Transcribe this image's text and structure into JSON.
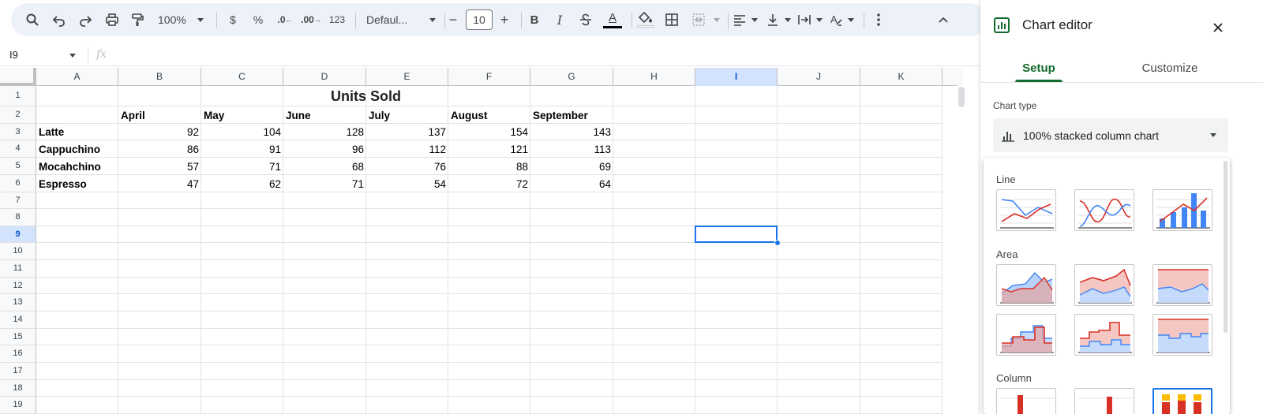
{
  "toolbar": {
    "zoom": "100%",
    "currency": "$",
    "percent": "%",
    "decrease_decimals": ".0",
    "increase_decimals": ".00",
    "number_format": "123",
    "font": "Defaul...",
    "font_size": "10",
    "minus": "−",
    "plus": "+",
    "bold": "B",
    "italic": "I",
    "text_color_letter": "A"
  },
  "formula_bar": {
    "name_box": "I9",
    "fx_label": "fx",
    "value": ""
  },
  "grid": {
    "columns": [
      "A",
      "B",
      "C",
      "D",
      "E",
      "F",
      "G",
      "H",
      "I",
      "J",
      "K"
    ],
    "selected_column": "I",
    "rows": [
      "1",
      "2",
      "3",
      "4",
      "5",
      "6",
      "7",
      "8",
      "9",
      "10",
      "11",
      "12",
      "13",
      "14",
      "15",
      "16",
      "17",
      "18",
      "19"
    ],
    "selected_row": "9",
    "title": "Units Sold",
    "months": [
      "April",
      "May",
      "June",
      "July",
      "August",
      "September"
    ],
    "data": [
      {
        "name": "Latte",
        "values": [
          "92",
          "104",
          "128",
          "137",
          "154",
          "143"
        ]
      },
      {
        "name": "Cappuchino",
        "values": [
          "86",
          "91",
          "96",
          "112",
          "121",
          "113"
        ]
      },
      {
        "name": "Mocahchino",
        "values": [
          "57",
          "71",
          "68",
          "76",
          "88",
          "69"
        ]
      },
      {
        "name": "Espresso",
        "values": [
          "47",
          "62",
          "71",
          "54",
          "72",
          "64"
        ]
      }
    ]
  },
  "editor": {
    "title": "Chart editor",
    "tabs": {
      "setup": "Setup",
      "customize": "Customize"
    },
    "chart_type_label": "Chart type",
    "chart_type_value": "100% stacked column chart",
    "sections": {
      "line": "Line",
      "area": "Area",
      "column": "Column"
    },
    "colors": {
      "accent": "#146c2e",
      "blue": "#1a73e8",
      "red": "#d93025",
      "yellow": "#fbbc04",
      "series_blue": "#4285f4"
    }
  }
}
